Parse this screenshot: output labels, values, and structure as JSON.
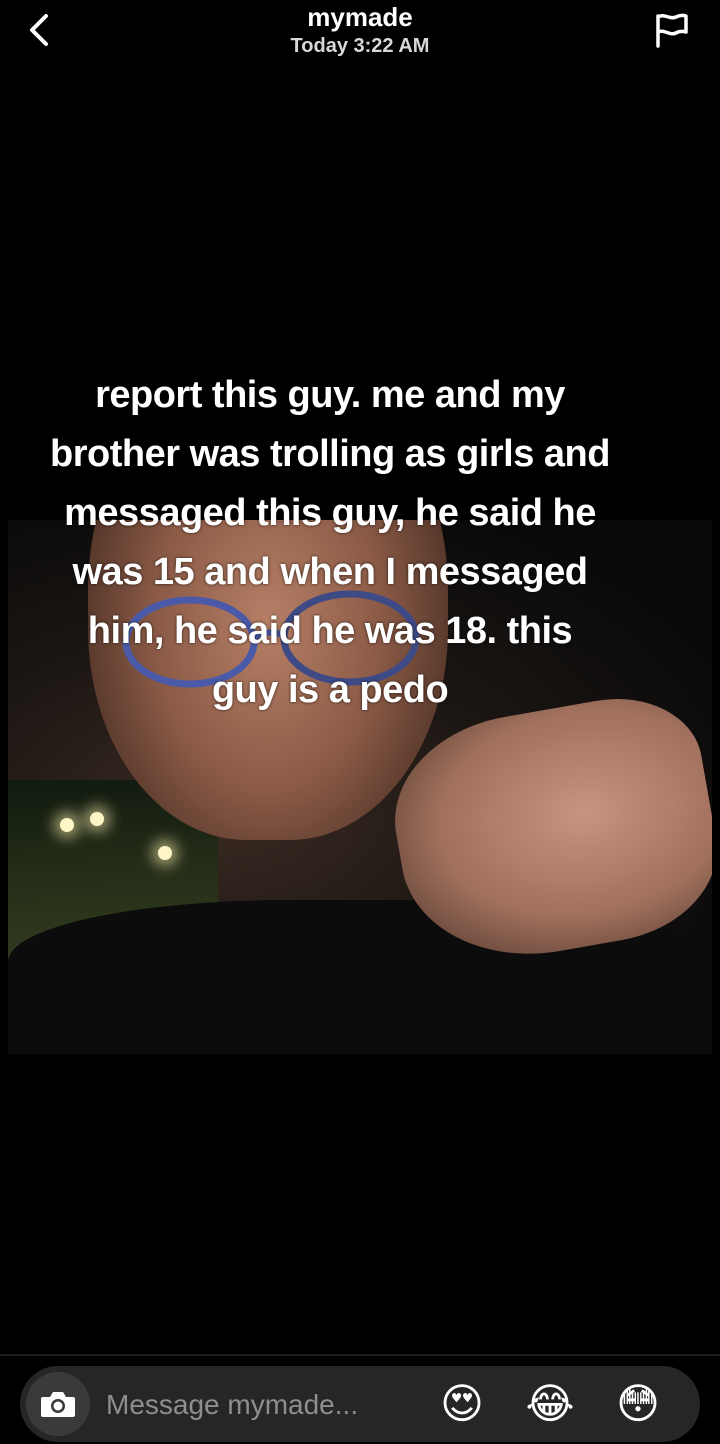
{
  "header": {
    "back_icon": "chevron-left-icon",
    "username": "mymade",
    "timestamp": "Today 3:22 AM",
    "flag_icon": "flag-icon"
  },
  "snap": {
    "caption": "report this guy. me and my brother was trolling as girls and messaged this guy, he said he was 15 and when I messaged him, he said he was 18. this guy is a pedo"
  },
  "composer": {
    "camera_icon": "camera-icon",
    "placeholder": "Message mymade...",
    "emojis": [
      {
        "name": "heart-eyes-emoji",
        "char": "😍"
      },
      {
        "name": "tears-of-joy-emoji",
        "char": "😂"
      },
      {
        "name": "flushed-emoji",
        "char": "😳"
      }
    ]
  },
  "colors": {
    "background": "#000000",
    "composer_bg": "#262626",
    "placeholder": "#8e8e8e"
  }
}
